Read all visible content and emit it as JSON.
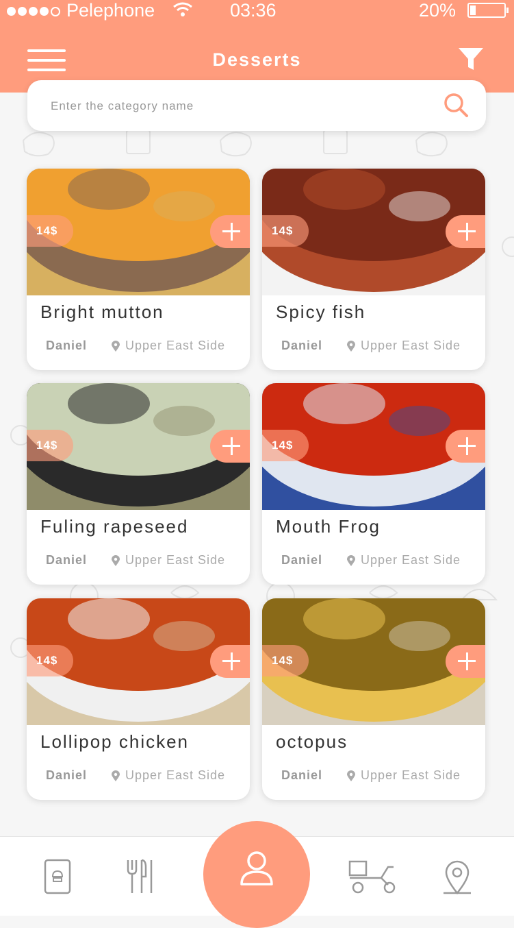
{
  "status_bar": {
    "carrier": "Pelephone",
    "time": "03:36",
    "battery": "20%"
  },
  "header": {
    "title": "Desserts"
  },
  "search": {
    "placeholder": "Enter the category name"
  },
  "cards": [
    {
      "price": "14$",
      "name": "Bright mutton",
      "author": "Daniel",
      "location": "Upper East Side",
      "colors": [
        "#f0a030",
        "#8a6a50",
        "#d7b060"
      ]
    },
    {
      "price": "14$",
      "name": "Spicy fish",
      "author": "Daniel",
      "location": "Upper East Side",
      "colors": [
        "#7a2a18",
        "#b04a2a",
        "#f3f3f3"
      ]
    },
    {
      "price": "14$",
      "name": "Fuling rapeseed",
      "author": "Daniel",
      "location": "Upper East Side",
      "colors": [
        "#c9d2b5",
        "#2a2a2a",
        "#8f8c6a"
      ]
    },
    {
      "price": "14$",
      "name": "Mouth Frog",
      "author": "Daniel",
      "location": "Upper East Side",
      "colors": [
        "#cc2a10",
        "#e0e6f0",
        "#3050a0"
      ]
    },
    {
      "price": "14$",
      "name": "Lollipop chicken",
      "author": "Daniel",
      "location": "Upper East Side",
      "colors": [
        "#c84818",
        "#f0f0f0",
        "#d8c8a8"
      ]
    },
    {
      "price": "14$",
      "name": "octopus",
      "author": "Daniel",
      "location": "Upper East Side",
      "colors": [
        "#8a6a18",
        "#e8c050",
        "#d8d0c0"
      ]
    }
  ],
  "accent_color": "#ff9c7d"
}
